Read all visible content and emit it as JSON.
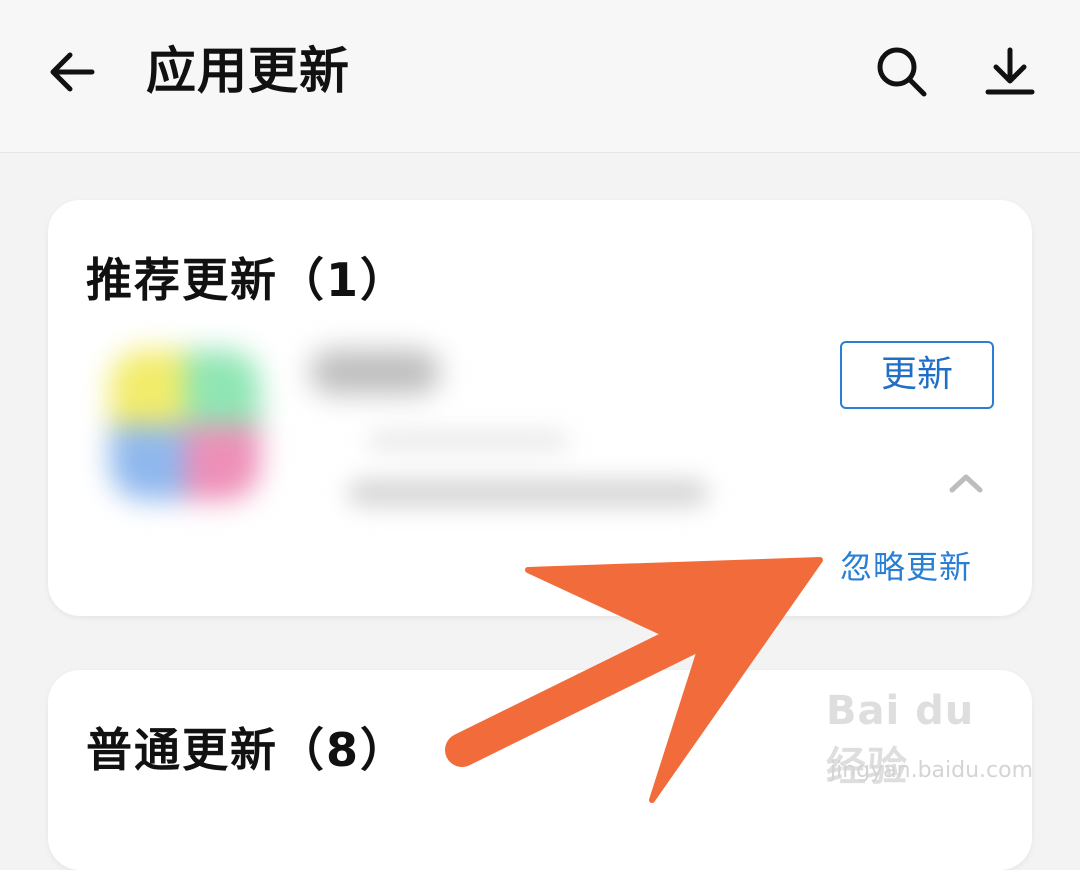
{
  "header": {
    "title": "应用更新"
  },
  "recommended": {
    "section_title": "推荐更新（1）",
    "update_label": "更新",
    "ignore_label": "忽略更新"
  },
  "normal": {
    "section_title": "普通更新（8）"
  },
  "watermark": {
    "brand": "Bai du 经验",
    "url": "jingyan.baidu.com"
  },
  "colors": {
    "accent": "#2a7fd4",
    "arrow": "#f26b3a"
  }
}
